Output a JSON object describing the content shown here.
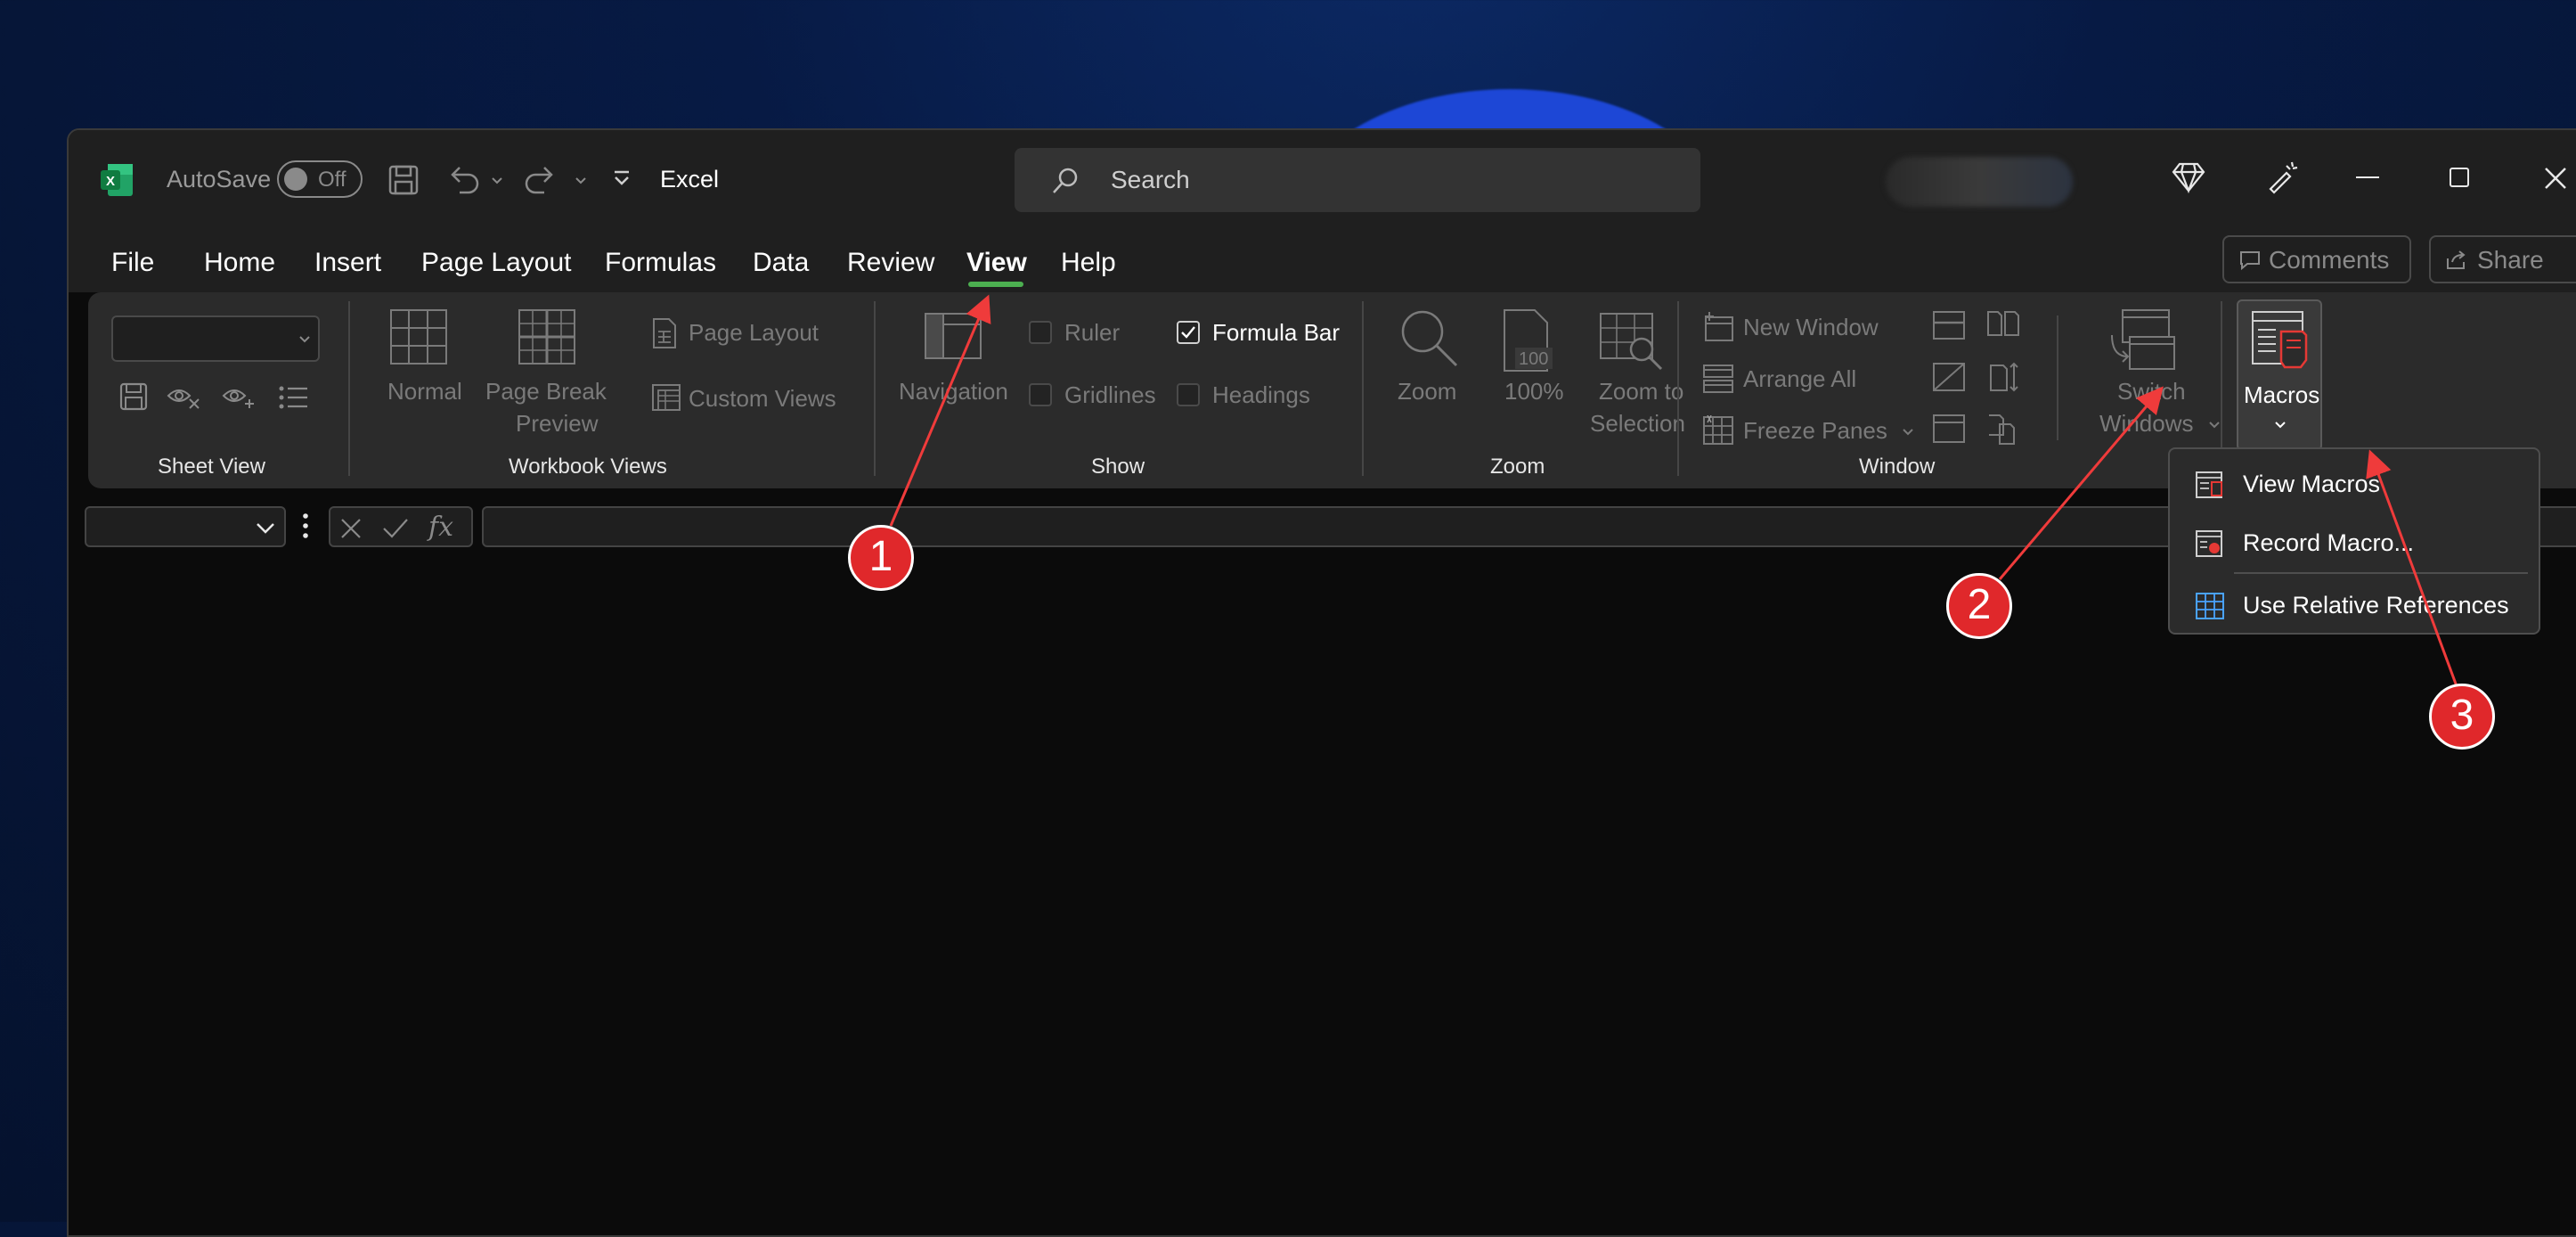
{
  "titlebar": {
    "autosave_label": "AutoSave",
    "autosave_state": "Off",
    "app_name": "Excel",
    "search_placeholder": "Search"
  },
  "tabs": [
    "File",
    "Home",
    "Insert",
    "Page Layout",
    "Formulas",
    "Data",
    "Review",
    "View",
    "Help"
  ],
  "active_tab": "View",
  "right_buttons": {
    "comments": "Comments",
    "share": "Share"
  },
  "ribbon": {
    "sheet_view": {
      "group_label": "Sheet View"
    },
    "workbook_views": {
      "group_label": "Workbook Views",
      "normal": "Normal",
      "page_break_line1": "Page Break",
      "page_break_line2": "Preview",
      "page_layout": "Page Layout",
      "custom_views": "Custom Views"
    },
    "show": {
      "group_label": "Show",
      "navigation": "Navigation",
      "ruler": "Ruler",
      "formula_bar": "Formula Bar",
      "gridlines": "Gridlines",
      "headings": "Headings",
      "formula_bar_checked": true
    },
    "zoom": {
      "group_label": "Zoom",
      "zoom": "Zoom",
      "hundred": "100%",
      "hundred_icon_text": "100",
      "zoom_sel_line1": "Zoom to",
      "zoom_sel_line2": "Selection"
    },
    "window": {
      "group_label": "Window",
      "new_window": "New Window",
      "arrange_all": "Arrange All",
      "freeze_panes": "Freeze Panes",
      "switch_line1": "Switch",
      "switch_line2": "Windows"
    },
    "macros": {
      "label": "Macros"
    }
  },
  "macros_menu": {
    "items": [
      "View Macros",
      "Record Macro...",
      "Use Relative References"
    ]
  },
  "annotations": [
    "1",
    "2",
    "3"
  ],
  "colors": {
    "accent_green": "#4caf50",
    "badge_red": "#e0282b",
    "arrow_red": "#ef3b3b"
  }
}
